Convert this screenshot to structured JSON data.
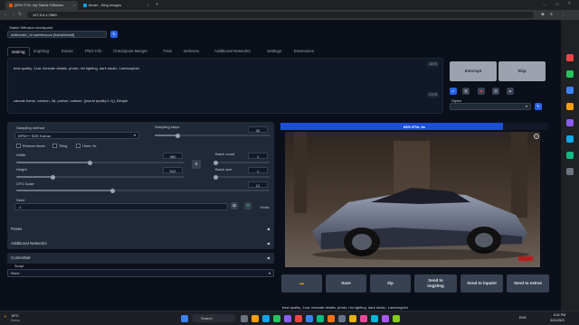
{
  "browser": {
    "tabs": [
      {
        "label": "[83% ETA: 4s] Stable Diffusion",
        "active": true
      },
      {
        "label": "ferrari - Bing images",
        "active": false
      }
    ],
    "url": "127.0.0.1:7860"
  },
  "checkpoint": {
    "label": "Stable Diffusion checkpoint",
    "value": "deliberate_v2.safetensors [9aba26abdf]"
  },
  "main_tabs": [
    "txt2img",
    "img2img",
    "Extras",
    "PNG Info",
    "Checkpoint Merger",
    "Train",
    "Deforum",
    "Additional Networks",
    "Settings",
    "Extensions"
  ],
  "prompt": {
    "positive": "best quality ,1car, intricate details, photo, rim lighting, dark studio, Lamborghini",
    "positive_count": "18/75",
    "negative": "canvas frame, cartoon, 3d, purism, cubism, ((worst quality:1.1)), Bexple",
    "negative_count": "21/75"
  },
  "actions": {
    "interrupt": "Interrupt",
    "skip": "Skip",
    "styles_label": "Styles"
  },
  "params": {
    "sampling_method_label": "Sampling method",
    "sampling_method_value": "DPM++ SDE Karras",
    "sampling_steps_label": "Sampling steps",
    "sampling_steps_value": "30",
    "restore_faces": "Restore faces",
    "tiling": "Tiling",
    "hires_fix": "Hires. fix",
    "width_label": "Width",
    "width_value": "960",
    "height_label": "Height",
    "height_value": "512",
    "batch_count_label": "Batch count",
    "batch_count_value": "1",
    "batch_size_label": "Batch size",
    "batch_size_value": "1",
    "cfg_label": "CFG Scale",
    "cfg_value": "12",
    "seed_label": "Seed",
    "seed_value": "-1",
    "extra_label": "Extra"
  },
  "sliders": {
    "steps": 0.2,
    "width": 0.44,
    "height": 0.22,
    "batch_count": 0.0,
    "batch_size": 0.0,
    "cfg": 0.38
  },
  "accordions": [
    "Posex",
    "Additional Networks",
    "ControlNet"
  ],
  "script": {
    "label": "Script",
    "value": "None"
  },
  "output": {
    "progress_text": "83% ETA: 4s",
    "progress": 0.83,
    "caption": "best quality ,1car, intricate details, photo, rim lighting, dark studio, Lamborghini"
  },
  "output_buttons": [
    "Save",
    "Zip",
    "Send to img2img",
    "Send to inpaint",
    "Send to extras"
  ],
  "taskbar": {
    "weather_temp": "19°C",
    "weather_desc": "Sunny",
    "search": "Search",
    "lang": "ENG",
    "time": "6:41 PM",
    "date": "3/21/2023"
  },
  "colors": {
    "accent_orange": "#ea580c",
    "progress_blue": "#1d4ed8",
    "icon_blue": "#2563eb"
  }
}
